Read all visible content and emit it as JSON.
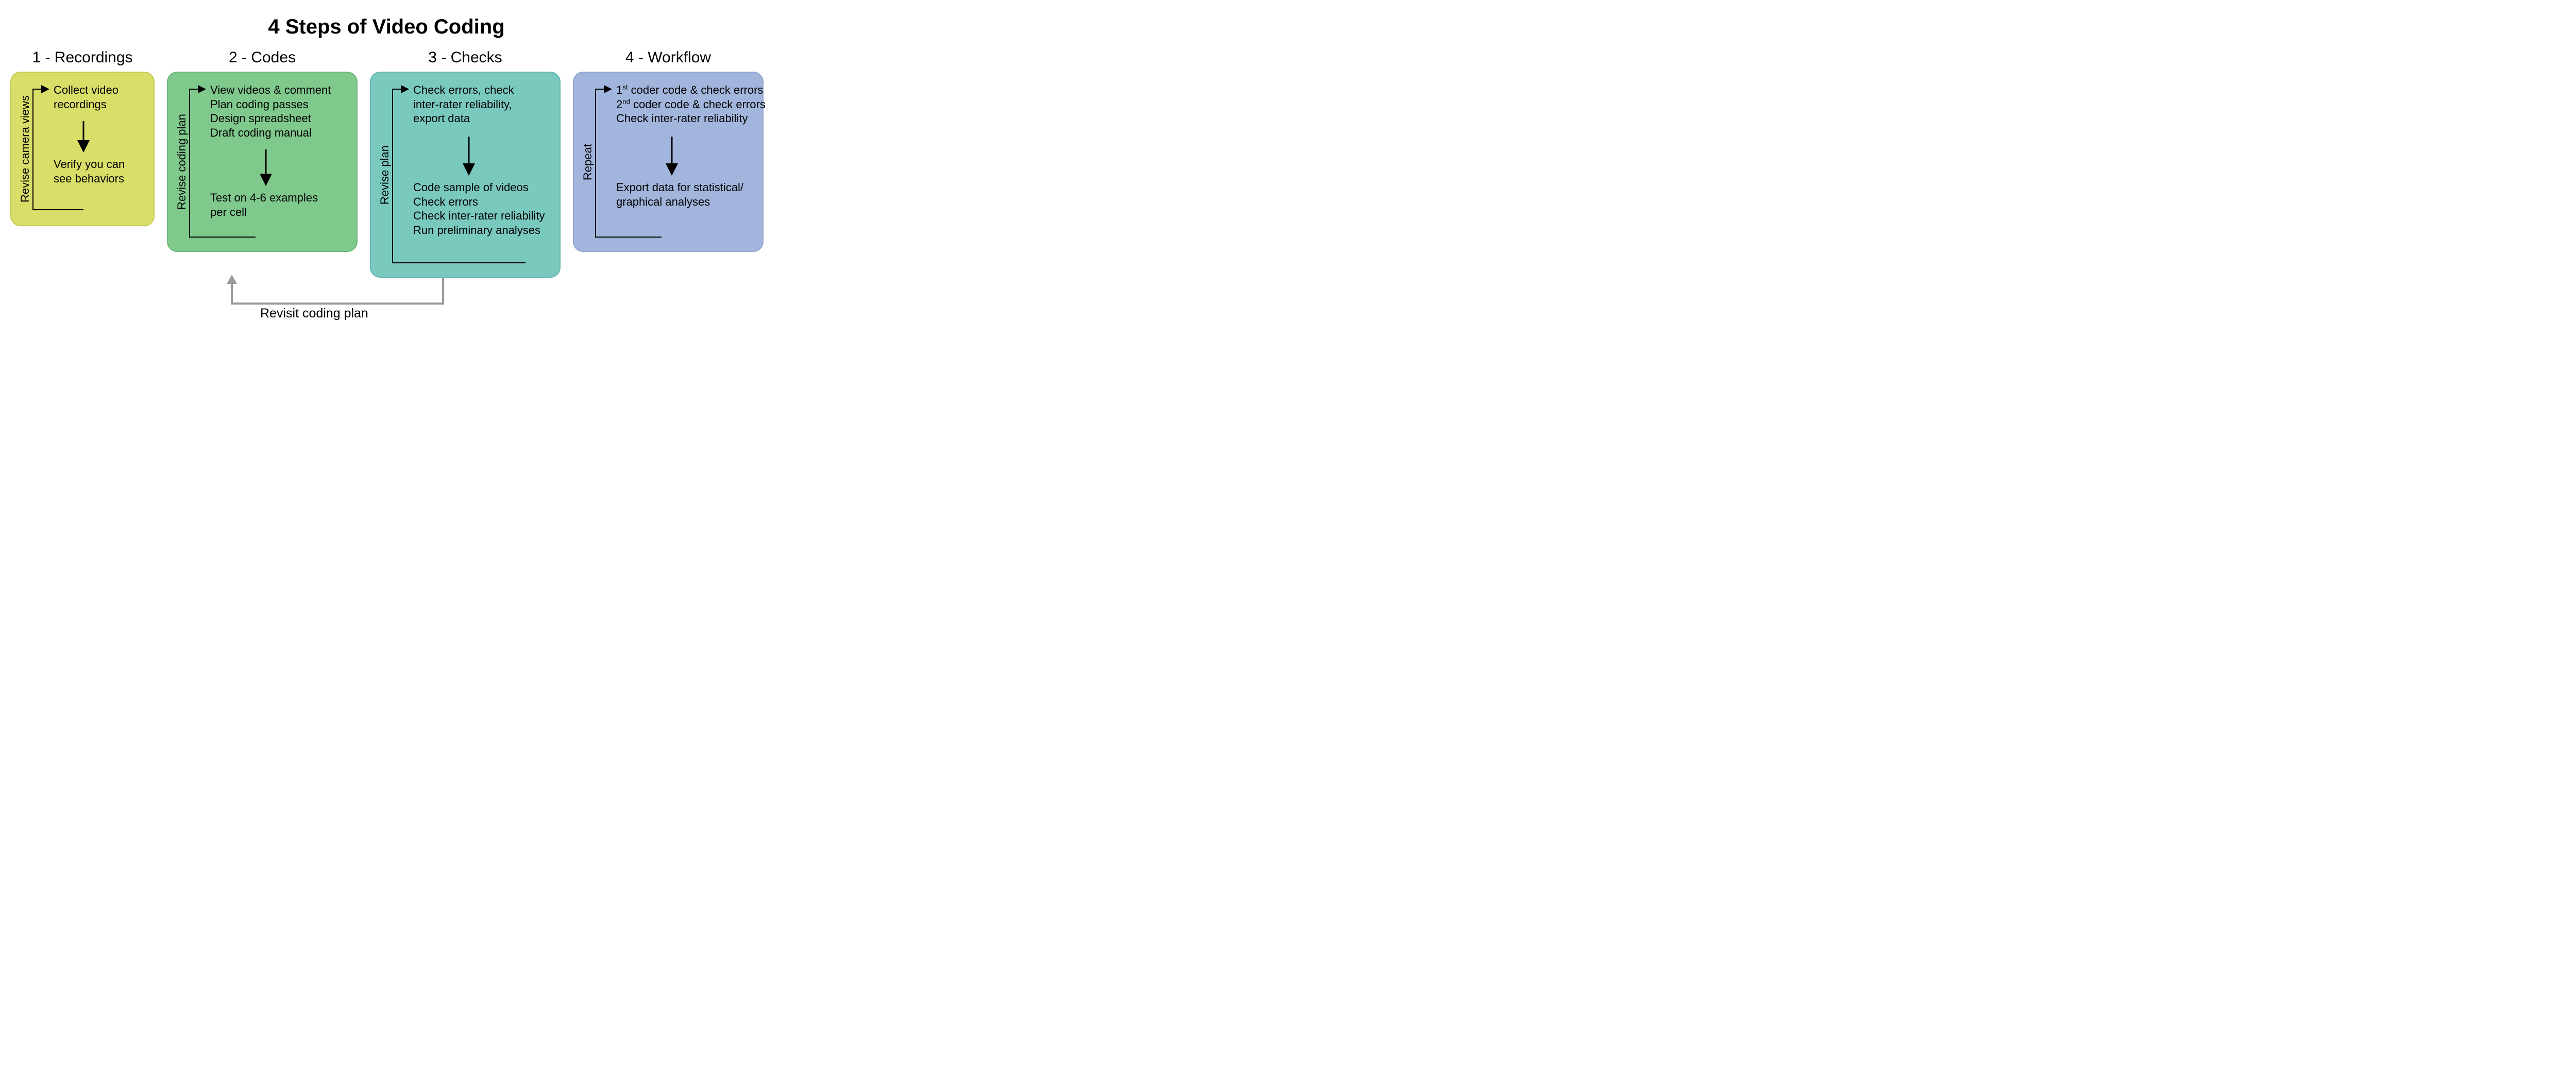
{
  "title": "4 Steps of Video Coding",
  "revisit_label": "Revisit coding plan",
  "steps": [
    {
      "heading": "1 - Recordings",
      "side_label": "Revise camera views",
      "top_lines": [
        "Collect video",
        "recordings"
      ],
      "bottom_lines": [
        "Verify you can",
        "see behaviors"
      ]
    },
    {
      "heading": "2 - Codes",
      "side_label": "Revise coding plan",
      "top_lines": [
        "View videos & comment",
        "Plan coding passes",
        "Design spreadsheet",
        "Draft coding manual"
      ],
      "bottom_lines": [
        "Test on 4-6 examples",
        "per cell"
      ]
    },
    {
      "heading": "3 - Checks",
      "side_label": "Revise plan",
      "top_lines": [
        "Check errors, check",
        "inter-rater reliability,",
        "export data"
      ],
      "bottom_lines": [
        "Code sample of videos",
        "Check errors",
        "Check inter-rater reliability",
        "Run preliminary analyses"
      ]
    },
    {
      "heading": "4 - Workflow",
      "side_label": "Repeat",
      "top_lines_html": [
        "1<sup>st</sup> coder code & check errors",
        "2<sup>nd</sup> coder code & check errors",
        "Check inter-rater reliability"
      ],
      "bottom_lines": [
        "Export data for statistical/",
        "graphical analyses"
      ]
    }
  ]
}
